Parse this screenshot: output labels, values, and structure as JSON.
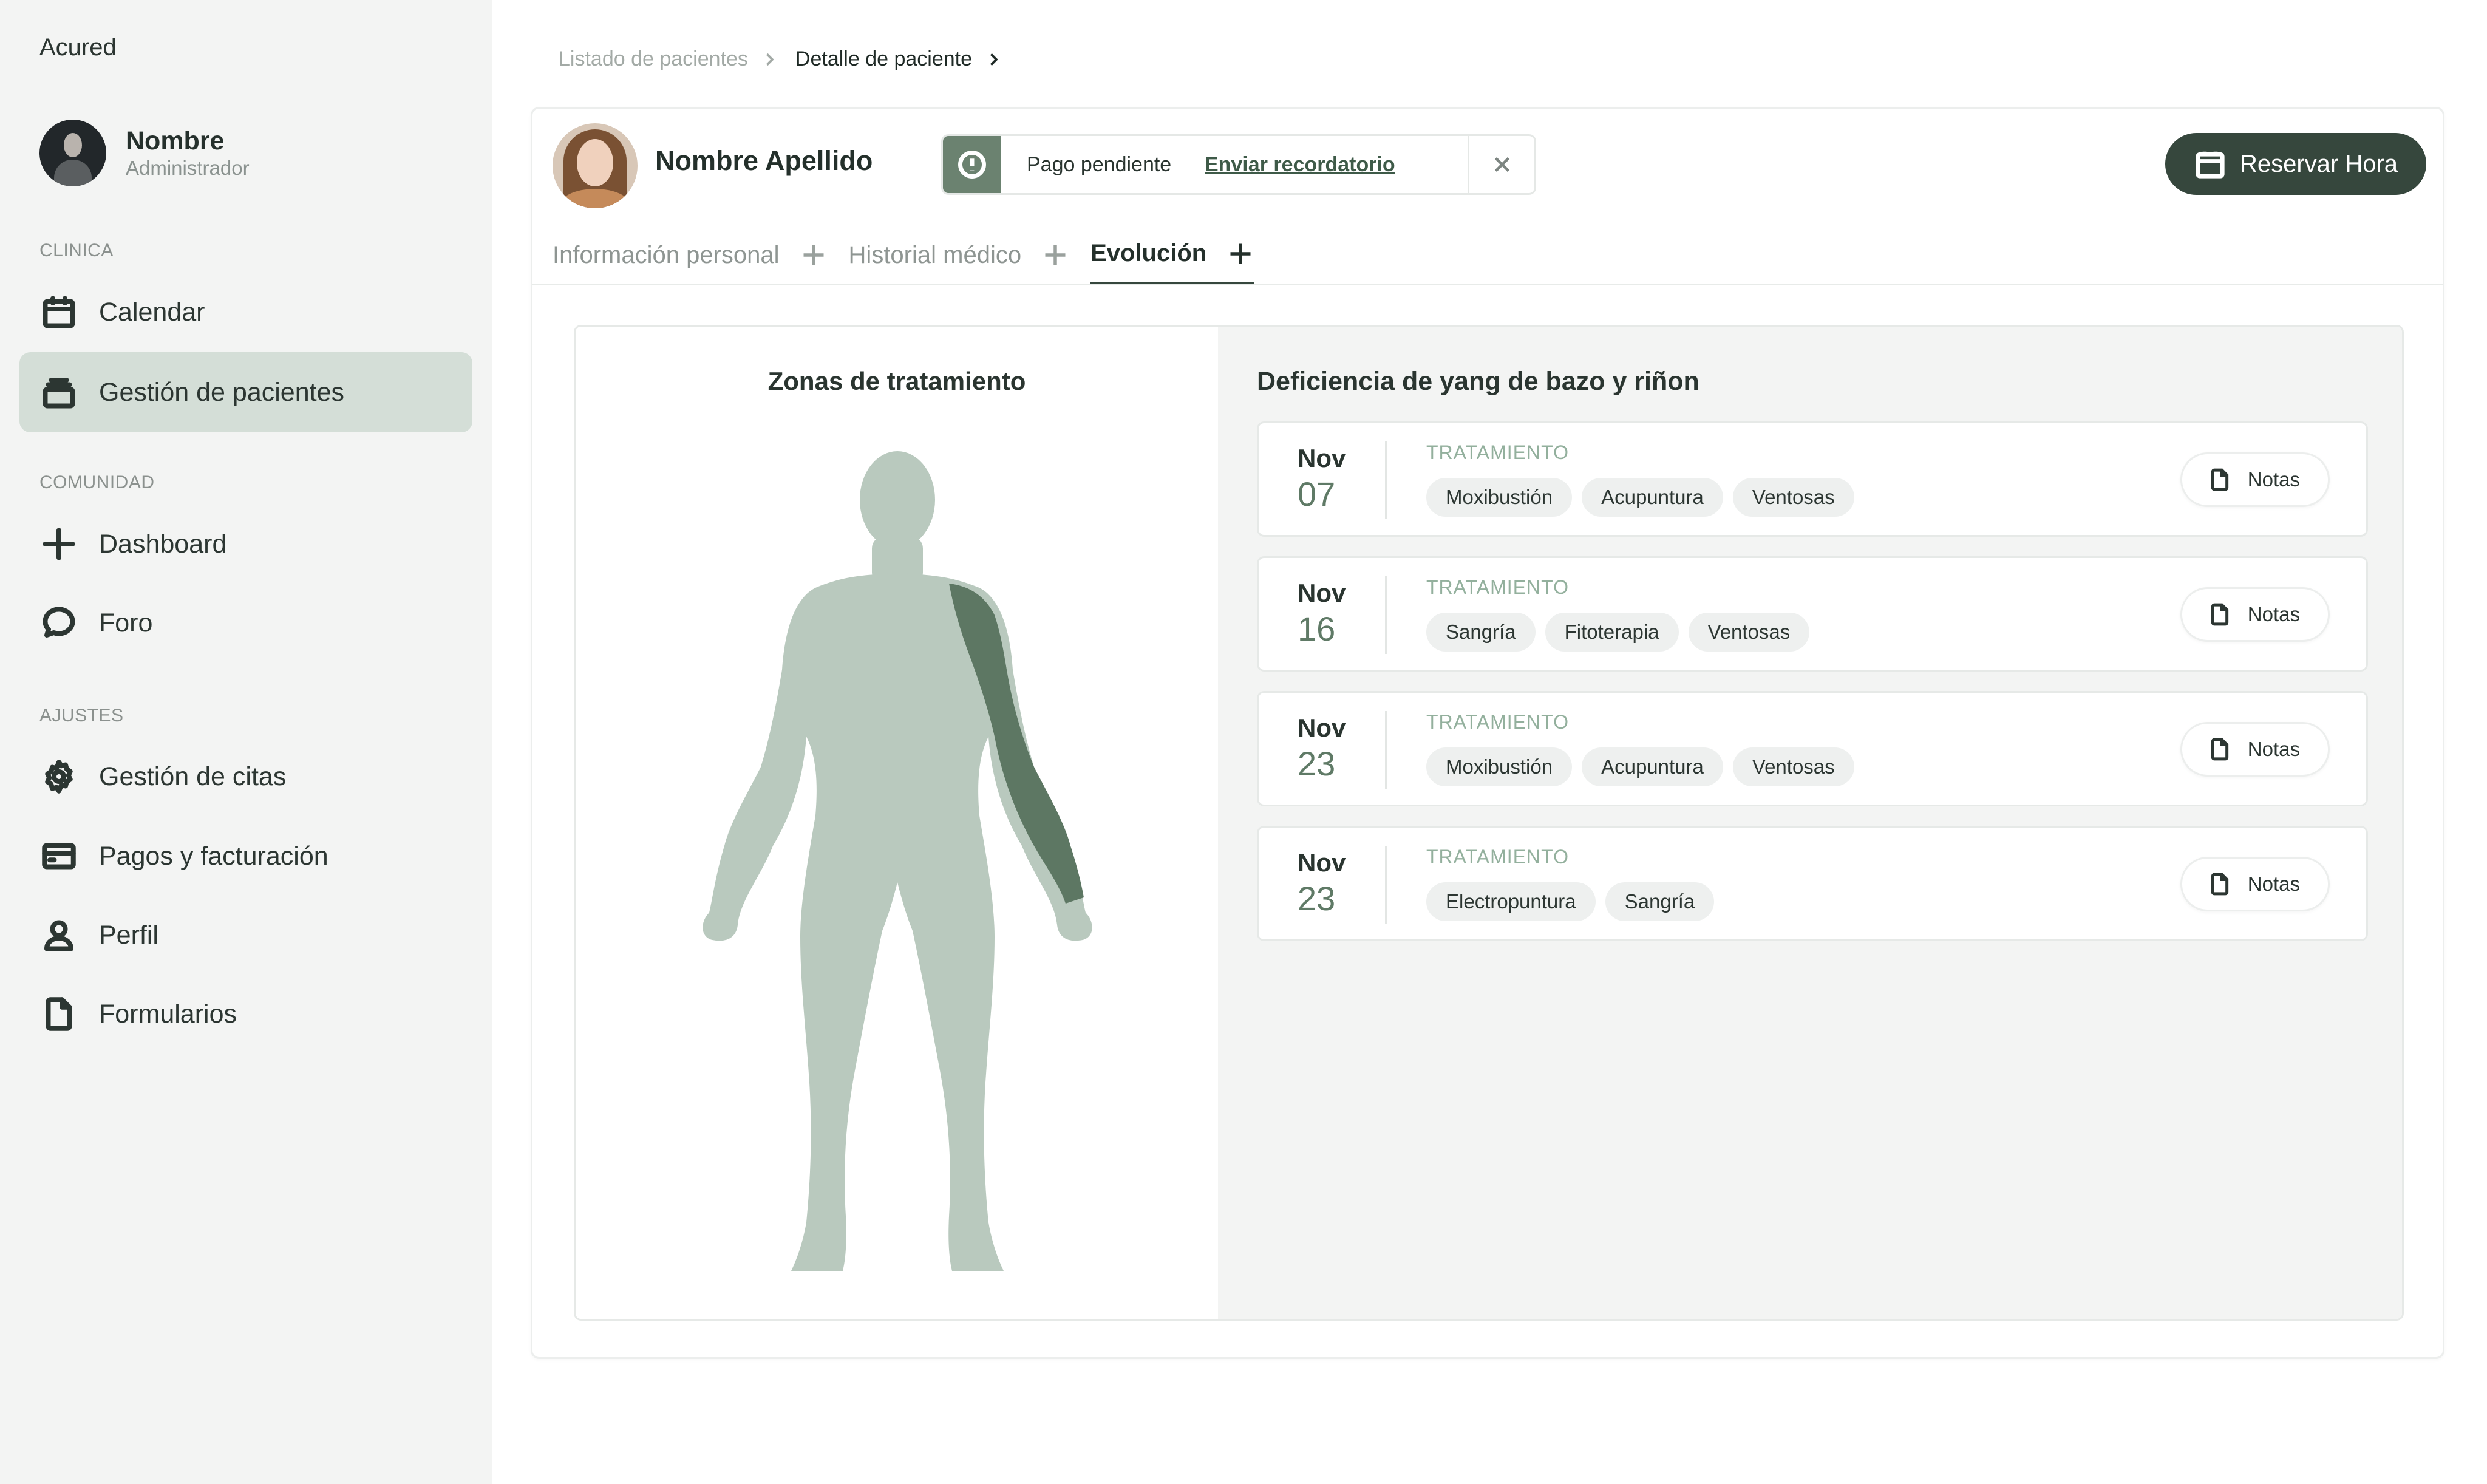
{
  "app": {
    "name": "Acured"
  },
  "user": {
    "name": "Nombre",
    "role": "Administrador"
  },
  "sidebar": {
    "sections": [
      {
        "label": "CLINICA"
      },
      {
        "label": "COMUNIDAD"
      },
      {
        "label": "AJUSTES"
      }
    ],
    "items": [
      {
        "label": "Calendar",
        "icon": "calendar-icon"
      },
      {
        "label": "Gestión de pacientes",
        "icon": "stack-icon",
        "active": true
      },
      {
        "label": "Dashboard",
        "icon": "plus-icon"
      },
      {
        "label": "Foro",
        "icon": "chat-icon"
      },
      {
        "label": "Gestión de citas",
        "icon": "gear-icon"
      },
      {
        "label": "Pagos y facturación",
        "icon": "credit-card-icon"
      },
      {
        "label": "Perfil",
        "icon": "user-icon"
      },
      {
        "label": "Formularios",
        "icon": "file-icon"
      }
    ]
  },
  "breadcrumb": {
    "items": [
      "Listado de pacientes",
      "Detalle de paciente"
    ]
  },
  "patient": {
    "name": "Nombre Apellido"
  },
  "alert": {
    "text": "Pago pendiente",
    "link": "Enviar recordatorio",
    "icon": "alert-circle-icon"
  },
  "actions": {
    "reserve_label": "Reservar Hora",
    "reserve_icon": "calendar-icon"
  },
  "tabs": [
    {
      "label": "Información personal",
      "active": false
    },
    {
      "label": "Historial médico",
      "active": false
    },
    {
      "label": "Evolución",
      "active": true
    }
  ],
  "zones": {
    "title": "Zonas de tratamiento",
    "highlighted_zone": "left-arm"
  },
  "evolution": {
    "title": "Deficiencia de yang de bazo y riñon",
    "notes_label": "Notas",
    "rows": [
      {
        "month": "Nov",
        "day": "07",
        "label": "TRATAMIENTO",
        "chips": [
          "Moxibustión",
          "Acupuntura",
          "Ventosas"
        ]
      },
      {
        "month": "Nov",
        "day": "16",
        "label": "TRATAMIENTO",
        "chips": [
          "Sangría",
          "Fitoterapia",
          "Ventosas"
        ]
      },
      {
        "month": "Nov",
        "day": "23",
        "label": "TRATAMIENTO",
        "chips": [
          "Moxibustión",
          "Acupuntura",
          "Ventosas"
        ]
      },
      {
        "month": "Nov",
        "day": "23",
        "label": "TRATAMIENTO",
        "chips": [
          "Electropuntura",
          "Sangría"
        ]
      }
    ]
  },
  "colors": {
    "accent_dark": "#36473d",
    "active_nav": "#d4ded7",
    "body_silhouette": "#b9c9be",
    "body_highlight": "#5d7763",
    "alert_icon_bg": "#6b8270"
  }
}
